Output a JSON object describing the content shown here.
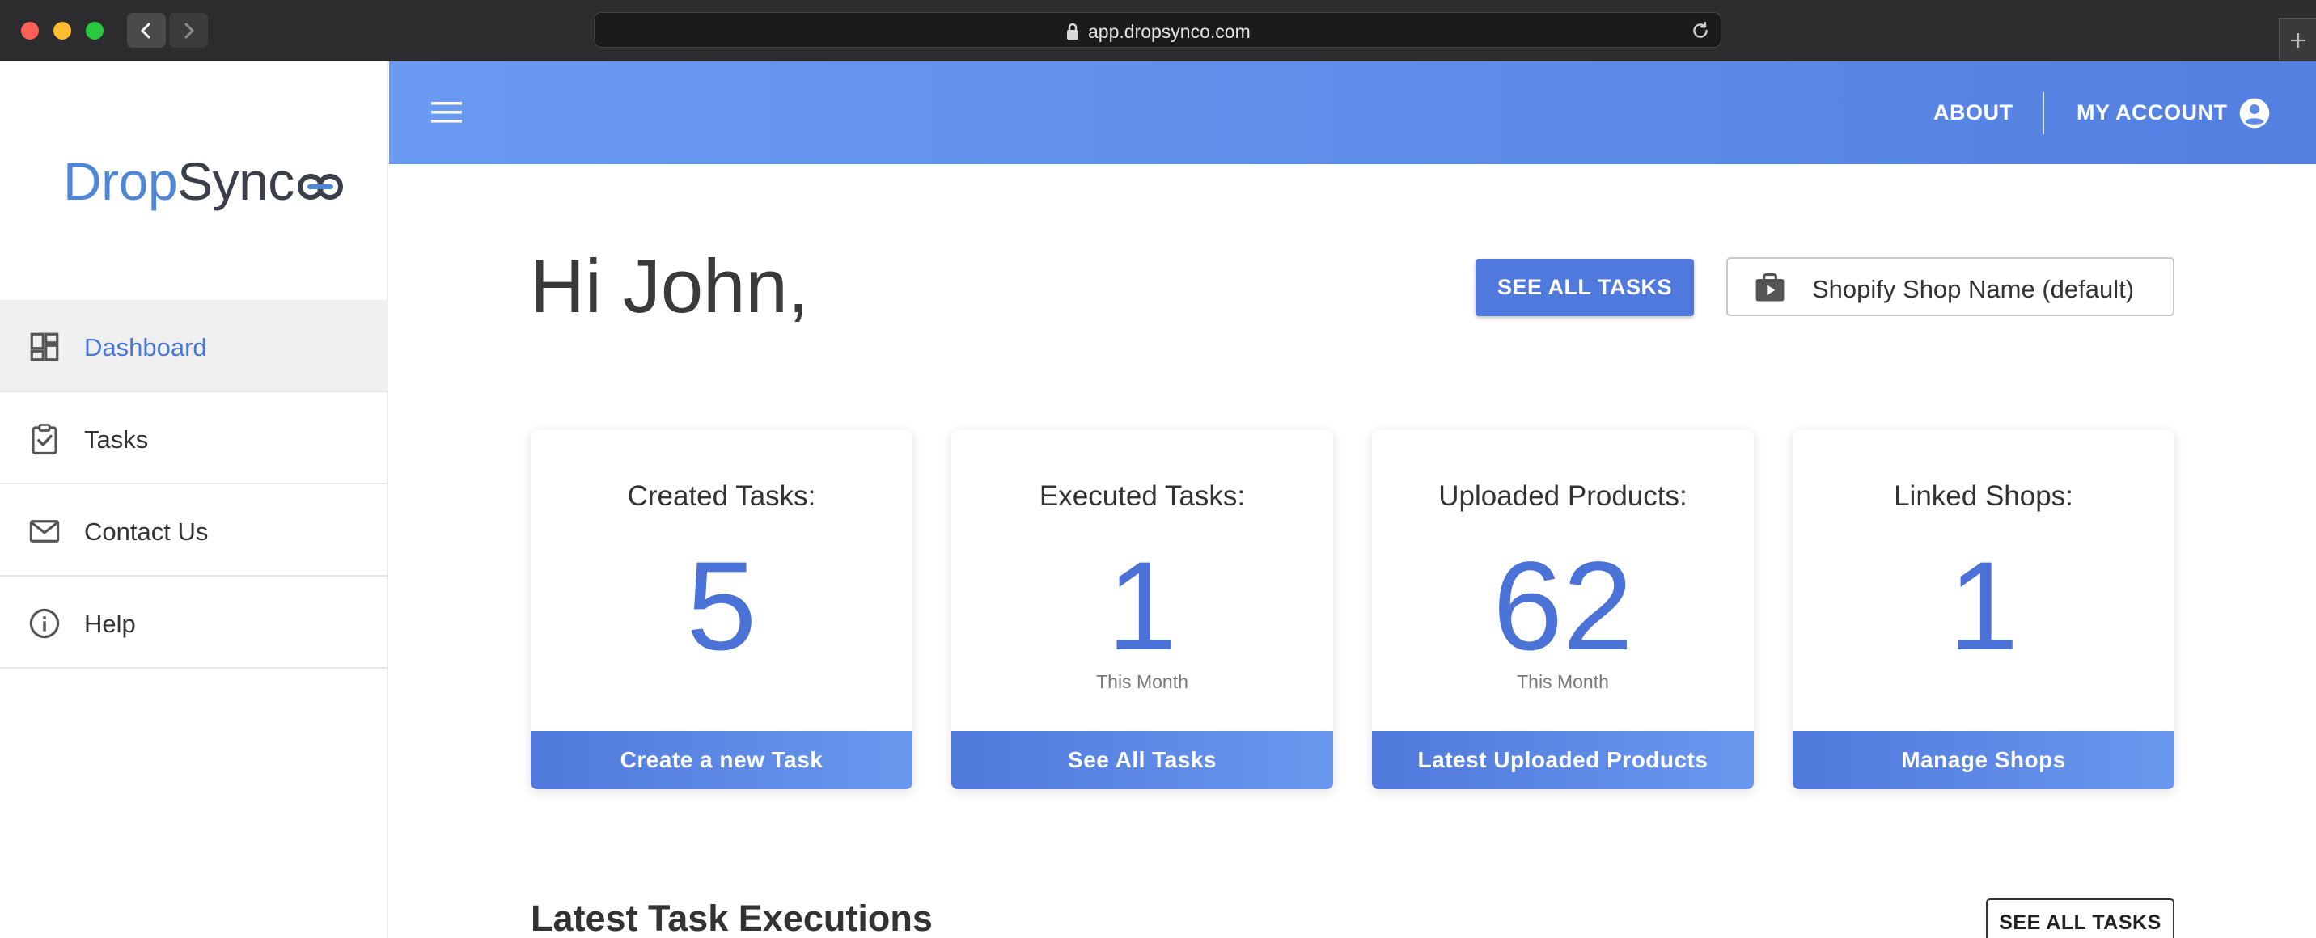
{
  "browser": {
    "url": "app.dropsynco.com"
  },
  "sidebar": {
    "logo": {
      "part1": "Drop",
      "part2": "Sync"
    },
    "items": [
      {
        "label": "Dashboard",
        "icon": "dashboard-icon",
        "active": true
      },
      {
        "label": "Tasks",
        "icon": "task-check-icon",
        "active": false
      },
      {
        "label": "Contact Us",
        "icon": "mail-icon",
        "active": false
      },
      {
        "label": "Help",
        "icon": "info-icon",
        "active": false
      }
    ]
  },
  "header": {
    "about": "ABOUT",
    "account": "MY ACCOUNT"
  },
  "main": {
    "greeting": "Hi John,",
    "see_all_tasks": "SEE ALL TASKS",
    "shop_selector": "Shopify Shop Name (default)",
    "cards": [
      {
        "title": "Created Tasks:",
        "value": "5",
        "sub": "",
        "button": "Create a new Task"
      },
      {
        "title": "Executed Tasks:",
        "value": "1",
        "sub": "This Month",
        "button": "See All Tasks"
      },
      {
        "title": "Uploaded Products:",
        "value": "62",
        "sub": "This Month",
        "button": "Latest Uploaded Products"
      },
      {
        "title": "Linked Shops:",
        "value": "1",
        "sub": "",
        "button": "Manage Shops"
      }
    ],
    "latest_section_title": "Latest Task Executions",
    "latest_see_all": "SEE ALL TASKS"
  },
  "colors": {
    "accent": "#4f79dc",
    "header_gradient_start": "#6a9af1",
    "header_gradient_end": "#537fe0",
    "active_menu_text": "#4a78d6",
    "card_value": "#4b73d7"
  }
}
